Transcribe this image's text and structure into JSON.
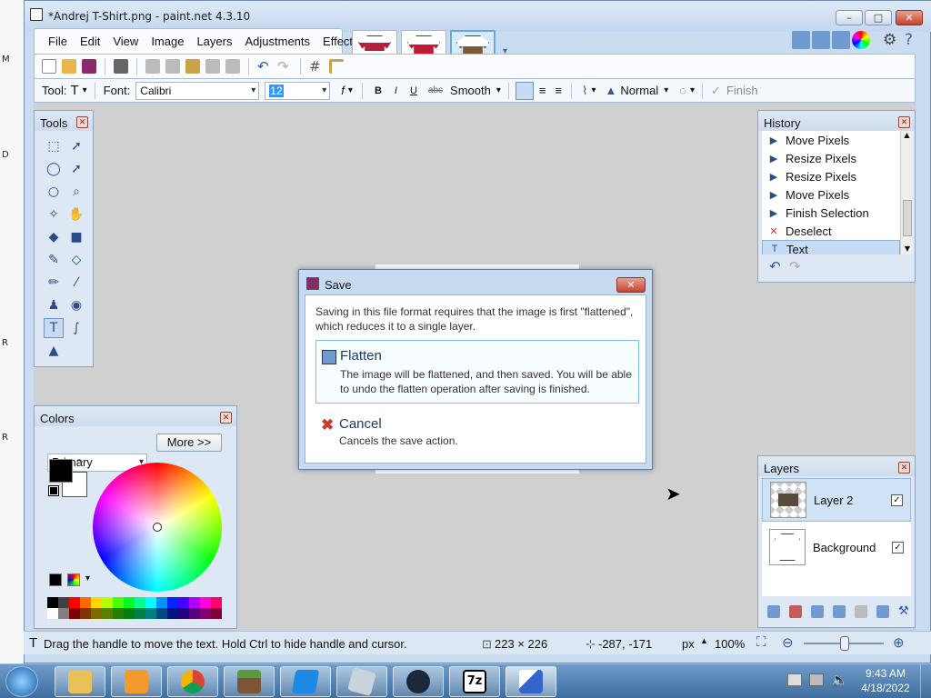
{
  "app": {
    "title": "*Andrej T-Shirt.png - paint.net 4.3.10",
    "window_buttons": [
      "–",
      "□",
      "✕"
    ]
  },
  "menu": [
    "File",
    "Edit",
    "View",
    "Image",
    "Layers",
    "Adjustments",
    "Effects"
  ],
  "textbar": {
    "tool_label": "Tool:",
    "font_label": "Font:",
    "font_value": "Calibri",
    "size_value": "12",
    "bold": "B",
    "italic": "I",
    "underline": "U",
    "strike": "abc",
    "antialias": "Smooth",
    "blend": "Normal",
    "finish": "Finish"
  },
  "tools_panel": {
    "title": "Tools"
  },
  "history_panel": {
    "title": "History",
    "items": [
      "Move Pixels",
      "Resize Pixels",
      "Resize Pixels",
      "Move Pixels",
      "Finish Selection",
      "Deselect",
      "Text"
    ],
    "selected_index": 6
  },
  "colors_panel": {
    "title": "Colors",
    "mode": "Primary",
    "more_button": "More >>",
    "primary_color": "#000000",
    "secondary_color": "#ffffff",
    "palette_top": [
      "#000000",
      "#404040",
      "#ff0000",
      "#ff6a00",
      "#ffd800",
      "#b6ff00",
      "#4cff00",
      "#00ff21",
      "#00ff90",
      "#00ffff",
      "#0094ff",
      "#0026ff",
      "#4800ff",
      "#b200ff",
      "#ff00dc",
      "#ff006e"
    ],
    "palette_bottom": [
      "#ffffff",
      "#808080",
      "#7f0000",
      "#7f3300",
      "#7f6a00",
      "#5b7f00",
      "#267f00",
      "#007f0e",
      "#007f46",
      "#007f7f",
      "#004a7f",
      "#00137f",
      "#21007f",
      "#57007f",
      "#7f006e",
      "#7f0037"
    ]
  },
  "layers_panel": {
    "title": "Layers",
    "layers": [
      {
        "name": "Layer 2",
        "visible": "✓"
      },
      {
        "name": "Background",
        "visible": "✓"
      }
    ]
  },
  "dialog": {
    "title": "Save",
    "message": "Saving in this file format requires that the image is first \"flattened\", which reduces it to a single layer.",
    "flatten_title": "Flatten",
    "flatten_desc": "The image will be flattened, and then saved. You will be able to undo the flatten operation after saving is finished.",
    "cancel_title": "Cancel",
    "cancel_desc": "Cancels the save action."
  },
  "status": {
    "hint": "Drag the handle to move the text. Hold Ctrl to hide handle and cursor.",
    "size": "223 × 226",
    "position": "-287, -171",
    "units": "px",
    "zoom": "100%"
  },
  "taskbar": {
    "time": "9:43 AM",
    "date": "4/18/2022"
  },
  "desktop_strip": [
    "M",
    "D",
    "R",
    "R"
  ]
}
